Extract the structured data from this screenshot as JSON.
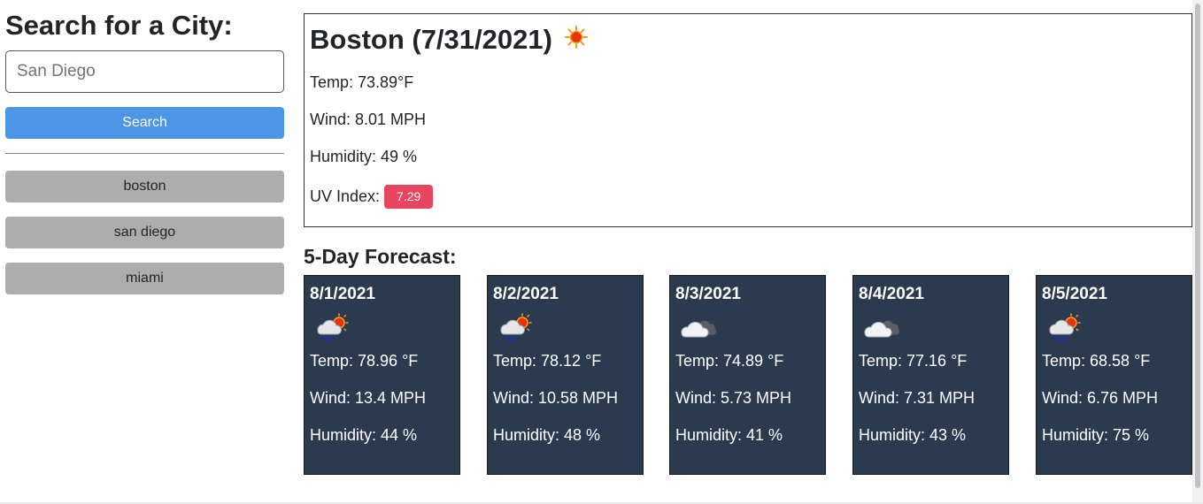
{
  "sidebar": {
    "heading": "Search for a City:",
    "search_placeholder": "San Diego",
    "search_value": "",
    "search_button": "Search",
    "history": [
      {
        "label": "boston"
      },
      {
        "label": "san diego"
      },
      {
        "label": "miami"
      }
    ]
  },
  "current": {
    "title": "Boston (7/31/2021)",
    "icon": "sun-icon",
    "temp": "Temp: 73.89°F",
    "wind": "Wind: 8.01 MPH",
    "humidity": "Humidity: 49 %",
    "uv_label": "UV Index:",
    "uv_value": "7.29",
    "uv_color": "#e94560"
  },
  "forecast": {
    "heading": "5-Day Forecast:",
    "days": [
      {
        "date": "8/1/2021",
        "icon": "rain-sun-icon",
        "temp": "Temp: 78.96 °F",
        "wind": "Wind: 13.4 MPH",
        "humidity": "Humidity: 44 %"
      },
      {
        "date": "8/2/2021",
        "icon": "rain-sun-icon",
        "temp": "Temp: 78.12 °F",
        "wind": "Wind: 10.58 MPH",
        "humidity": "Humidity: 48 %"
      },
      {
        "date": "8/3/2021",
        "icon": "cloud-icon",
        "temp": "Temp: 74.89 °F",
        "wind": "Wind: 5.73 MPH",
        "humidity": "Humidity: 41 %"
      },
      {
        "date": "8/4/2021",
        "icon": "cloud-icon",
        "temp": "Temp: 77.16 °F",
        "wind": "Wind: 7.31 MPH",
        "humidity": "Humidity: 43 %"
      },
      {
        "date": "8/5/2021",
        "icon": "rain-sun-icon",
        "temp": "Temp: 68.58 °F",
        "wind": "Wind: 6.76 MPH",
        "humidity": "Humidity: 75 %"
      }
    ]
  },
  "colors": {
    "search_button": "#4c96e5",
    "history_button": "#adadad",
    "forecast_card": "#2b3a4e"
  }
}
